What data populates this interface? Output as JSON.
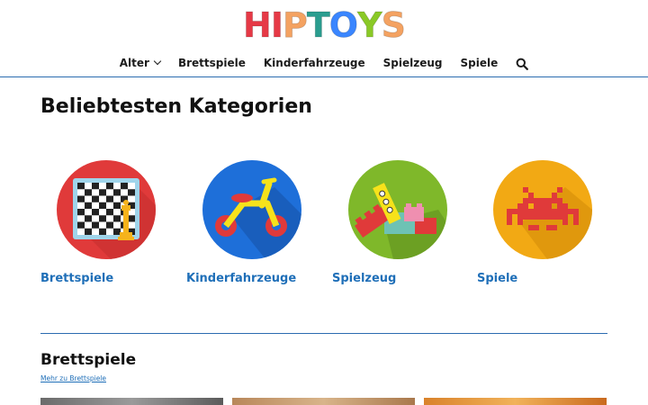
{
  "brand": {
    "logo_text": "HIPTOYS",
    "logo_colors": [
      "#e63946",
      "#e63946",
      "#f4a261",
      "#2a9d8f",
      "#3a86ff",
      "#8ac926",
      "#f4a261"
    ]
  },
  "nav": {
    "items": [
      {
        "label": "Alter",
        "has_dropdown": true
      },
      {
        "label": "Brettspiele"
      },
      {
        "label": "Kinderfahrzeuge"
      },
      {
        "label": "Spielzeug"
      },
      {
        "label": "Spiele"
      }
    ],
    "search_icon": "search-icon"
  },
  "main": {
    "title": "Beliebtesten Kategorien",
    "categories": [
      {
        "label": "Brettspiele",
        "icon": "chessboard-icon",
        "color": "#e03a3a"
      },
      {
        "label": "Kinderfahrzeuge",
        "icon": "balance-bike-icon",
        "color": "#1e6fd9"
      },
      {
        "label": "Spielzeug",
        "icon": "building-blocks-icon",
        "color": "#7fb82a"
      },
      {
        "label": "Spiele",
        "icon": "space-invader-icon",
        "color": "#f2a914"
      }
    ]
  },
  "section": {
    "title": "Brettspiele",
    "more_link": "Mehr zu Brettspiele"
  },
  "colors": {
    "accent": "#1f6fb8",
    "divider": "#2b6cb0"
  }
}
